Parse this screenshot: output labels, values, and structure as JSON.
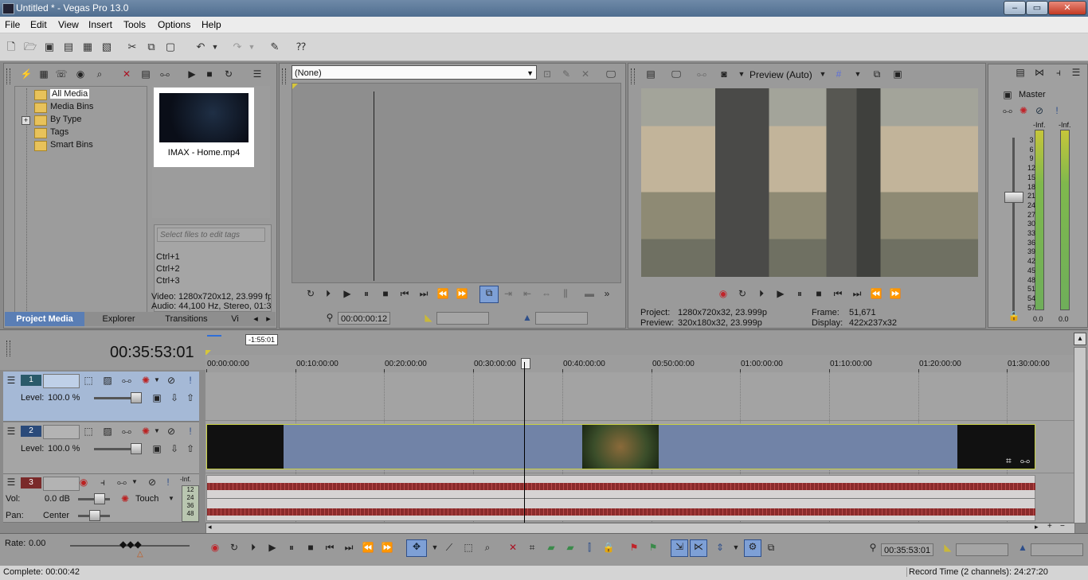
{
  "window": {
    "title": "Untitled * - Vegas Pro 13.0",
    "minimize": "–",
    "maximize": "▭",
    "close": "✕"
  },
  "menu": [
    "File",
    "Edit",
    "View",
    "Insert",
    "Tools",
    "Options",
    "Help"
  ],
  "project_media": {
    "tree": [
      "All Media",
      "Media Bins",
      "By Type",
      "Tags",
      "Smart Bins"
    ],
    "tree_expander": "+",
    "file_name": "IMAX - Home.mp4",
    "tags_placeholder": "Select files to edit tags",
    "shortcuts": [
      "Ctrl+1",
      "Ctrl+2",
      "Ctrl+3"
    ],
    "video_info": "Video: 1280x720x12, 23.999 fps",
    "audio_info": "Audio: 44,100 Hz, Stereo, 01:3",
    "tabs": [
      "Project Media",
      "Explorer",
      "Transitions",
      "Vi"
    ]
  },
  "trimmer": {
    "select_value": "(None)",
    "timecode": "00:00:00:12"
  },
  "preview": {
    "mode": "Preview (Auto)",
    "project_label": "Project:",
    "project_value": "1280x720x32, 23.999p",
    "preview_label": "Preview:",
    "preview_value": "320x180x32, 23.999p",
    "frame_label": "Frame:",
    "frame_value": "51,671",
    "display_label": "Display:",
    "display_value": "422x237x32"
  },
  "master": {
    "title": "Master",
    "inf_left": "-Inf.",
    "inf_right": "-Inf.",
    "scale": [
      "3",
      "6",
      "9",
      "12",
      "15",
      "18",
      "21",
      "24",
      "27",
      "30",
      "33",
      "36",
      "39",
      "42",
      "45",
      "48",
      "51",
      "54",
      "57"
    ],
    "left_value": "0.0",
    "right_value": "0.0"
  },
  "timeline": {
    "current_time": "00:35:53:01",
    "marker_time": "-1:55:01",
    "ruler": [
      "00:00:00:00",
      "00:10:00:00",
      "00:20:00:00",
      "00:30:00:00",
      "00:40:00:00",
      "00:50:00:00",
      "01:00:00:00",
      "01:10:00:00",
      "01:20:00:00",
      "01:30:00:00"
    ],
    "tracks": [
      {
        "number": "1",
        "level_label": "Level:",
        "level_value": "100.0 %"
      },
      {
        "number": "2",
        "level_label": "Level:",
        "level_value": "100.0 %"
      },
      {
        "number": "3",
        "vol_label": "Vol:",
        "vol_value": "0.0 dB",
        "pan_label": "Pan:",
        "pan_value": "Center",
        "automation": "Touch",
        "meter_top": "-Inf.",
        "meter_scale": [
          "12",
          "24",
          "36",
          "48"
        ]
      }
    ]
  },
  "transport": {
    "rate_label": "Rate:",
    "rate_value": "0.00",
    "cursor_time": "00:35:53:01"
  },
  "status": {
    "complete": "Complete: 00:00:42",
    "record_time": "Record Time (2 channels): 24:27:20"
  },
  "colors": {
    "accent": "#5a7eb5",
    "video_event": "#7183a7",
    "waveform": "#8b2b2b",
    "selection_border": "#c8d042"
  }
}
